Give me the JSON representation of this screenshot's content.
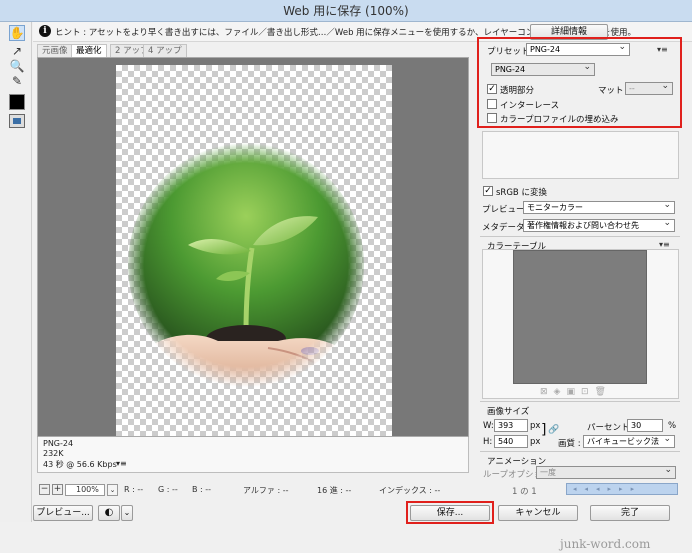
{
  "window": {
    "title": "Web 用に保存 (100%)"
  },
  "hint": {
    "text": "ヒント : アセットをより早く書き出すには、ファイル／書き出し形式…／Web 用に保存メニューを使用するか、レイヤーコンテキストメニューを使用。",
    "detail_button": "詳細情報"
  },
  "tabs": [
    "元画像",
    "最適化",
    "2 アップ",
    "4 アップ"
  ],
  "image_info": {
    "format": "PNG-24",
    "size": "232K",
    "time": "43 秒 @ 56.6 Kbps",
    "menu": "▾≡"
  },
  "status": {
    "zoom": "100%",
    "r": "R : --",
    "g": "G : --",
    "b": "B : --",
    "alpha": "アルファ : --",
    "hex": "16 進 : --",
    "index": "インデックス : --"
  },
  "buttons": {
    "preview": "プレビュー...",
    "save": "保存...",
    "cancel": "キャンセル",
    "done": "完了"
  },
  "settings": {
    "preset_label": "プリセット :",
    "preset_value": "PNG-24",
    "format_value": "PNG-24",
    "transparency_label": "透明部分",
    "transparency_checked": "✓",
    "matte_label": "マット :",
    "matte_value": "--",
    "interlace_label": "インターレース",
    "embed_profile_label": "カラープロファイルの埋め込み",
    "srgb_label": "sRGB に変換",
    "srgb_checked": "✓",
    "preview_label": "プレビュー :",
    "preview_value": "モニターカラー",
    "metadata_label": "メタデータ :",
    "metadata_value": "著作権情報および問い合わせ先",
    "color_table_label": "カラーテーブル"
  },
  "image_size": {
    "title": "画像サイズ",
    "w_label": "W:",
    "w_value": "393",
    "w_unit": "px",
    "h_label": "H:",
    "h_value": "540",
    "h_unit": "px",
    "percent_label": "パーセント :",
    "percent_value": "30",
    "percent_unit": "%",
    "quality_label": "画質 :",
    "quality_value": "バイキュービック法"
  },
  "animation": {
    "title": "アニメーション",
    "loop_label": "ループオプション :",
    "loop_value": "一度",
    "frame": "1 の 1"
  },
  "watermark": "junk-word.com"
}
